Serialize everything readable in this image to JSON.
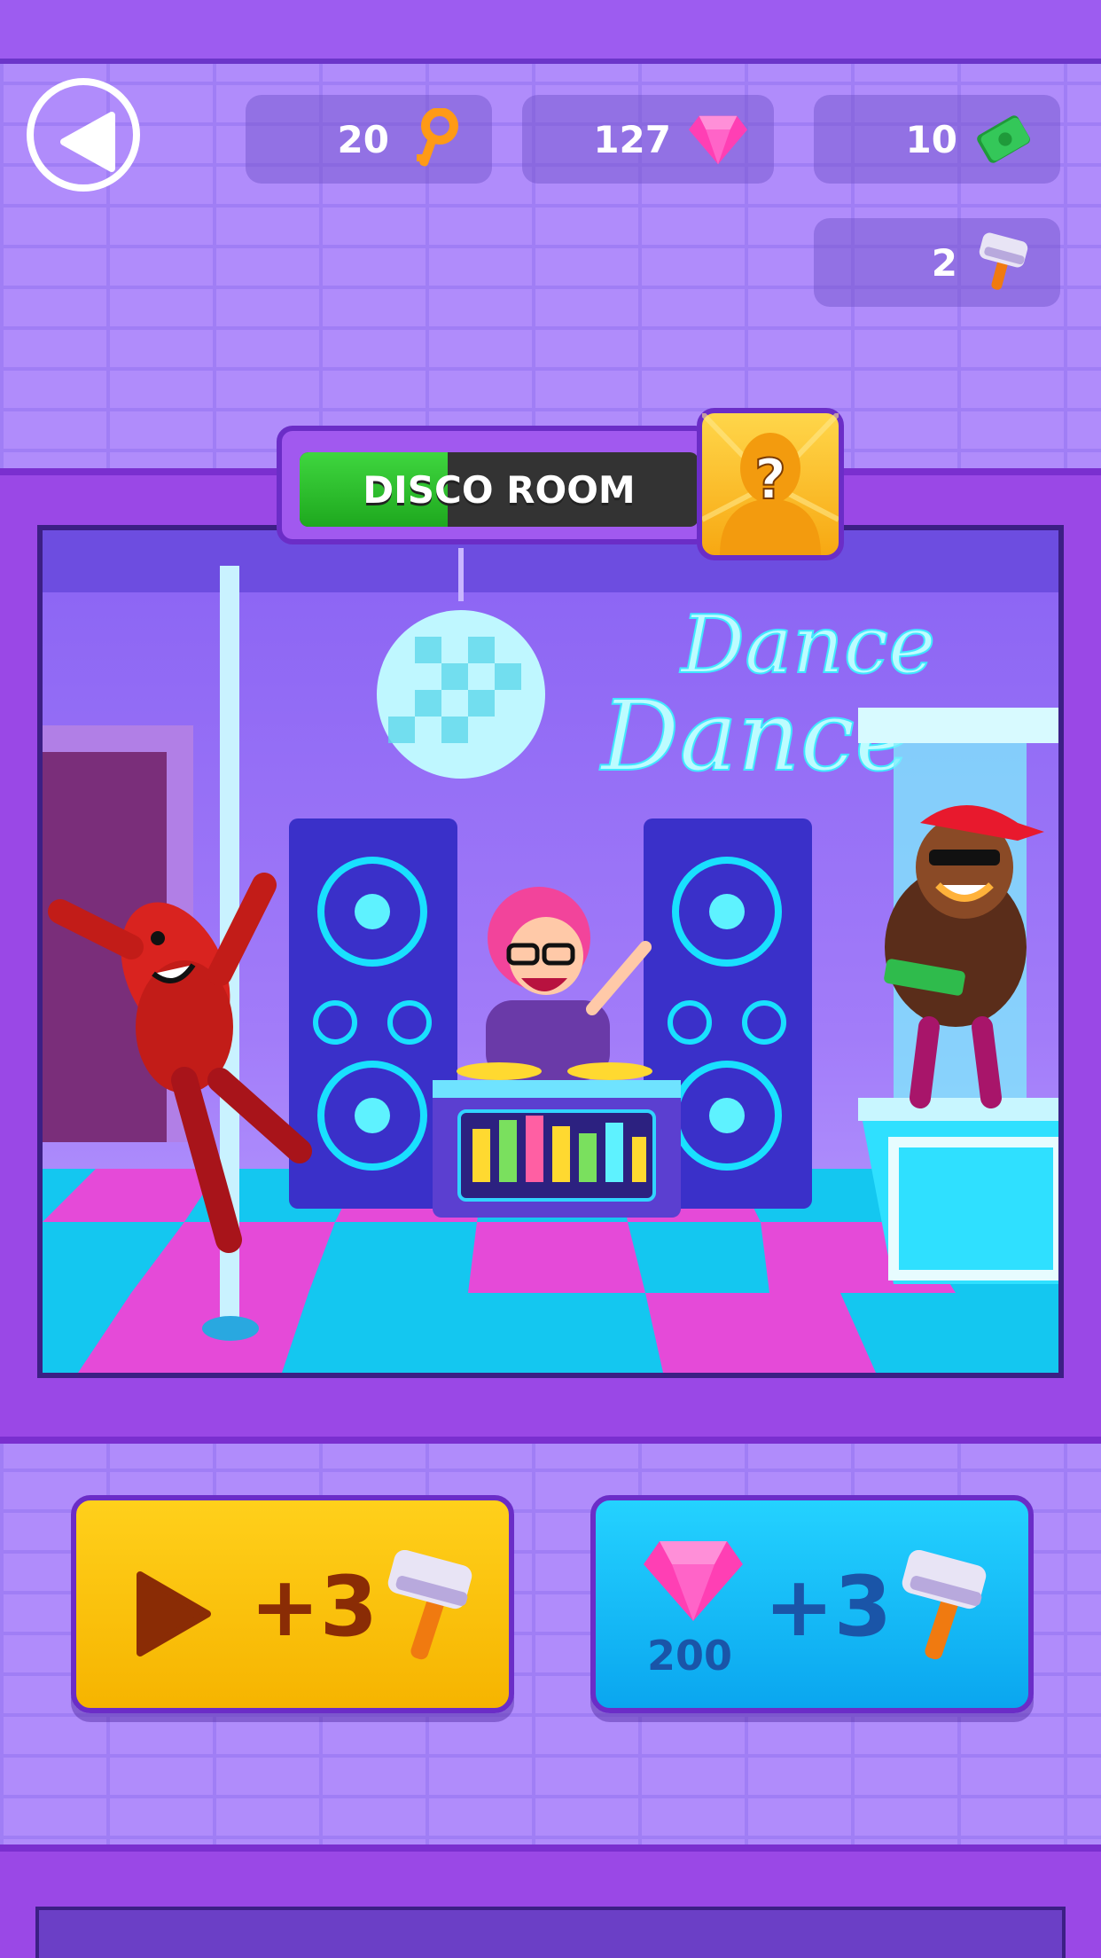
{
  "currencies": {
    "keys": {
      "value": "20",
      "icon": "key-icon"
    },
    "gems": {
      "value": "127",
      "icon": "gem-icon"
    },
    "cash": {
      "value": "10",
      "icon": "cash-icon"
    },
    "hammers": {
      "value": "2",
      "icon": "hammer-icon"
    }
  },
  "room": {
    "title_part1": "DISCO",
    "title_part2": "ROOM",
    "progress_fraction": 0.37,
    "sign_line1": "Dance",
    "sign_line2": "Dance"
  },
  "actions": {
    "video": {
      "reward": "+3",
      "icon": "play-icon"
    },
    "gem": {
      "reward": "+3",
      "cost": "200",
      "icon": "gem-icon"
    }
  },
  "colors": {
    "accent_yellow": "#ffd01b",
    "accent_blue": "#0aa6ef",
    "progress_green": "#1ea81e",
    "frame_purple": "#9a48e6"
  }
}
